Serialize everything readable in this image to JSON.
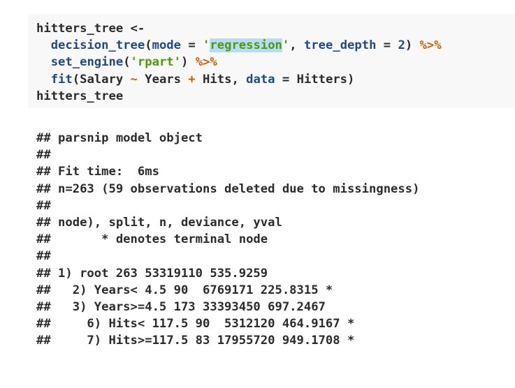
{
  "code": {
    "line1": "hitters_tree <-",
    "line2": {
      "fn": "decision_tree",
      "open": "(",
      "arg1": "mode",
      "eq1": " = ",
      "quote_open": "'",
      "str_hl": "regression",
      "quote_close": "'",
      "comma": ", ",
      "arg2": "tree_depth",
      "eq2": " = ",
      "num": "2",
      "close": ") ",
      "pipe": "%>%"
    },
    "line3": {
      "fn": "set_engine",
      "open": "(",
      "str": "'rpart'",
      "close": ") ",
      "pipe": "%>%"
    },
    "line4": {
      "fn": "fit",
      "open": "(Salary ",
      "tilde": "~",
      "mid": " Years ",
      "plus": "+",
      "mid2": " Hits, ",
      "arg": "data",
      "eq": " = ",
      "rest": "Hitters)"
    },
    "line5": "hitters_tree"
  },
  "output": [
    "## parsnip model object",
    "##",
    "## Fit time:  6ms",
    "## n=263 (59 observations deleted due to missingness)",
    "##",
    "## node), split, n, deviance, yval",
    "##       * denotes terminal node",
    "##",
    "## 1) root 263 53319110 535.9259",
    "##   2) Years< 4.5 90  6769171 225.8315 *",
    "##   3) Years>=4.5 173 33393450 697.2467",
    "##     6) Hits< 117.5 90  5312120 464.9167 *",
    "##     7) Hits>=117.5 83 17955720 949.1708 *"
  ],
  "colors": {
    "code_bg": "#f8f8f8",
    "function": "#204a87",
    "string": "#4e9a06",
    "operator": "#ce5c00",
    "highlight": "#b8dcf3"
  }
}
